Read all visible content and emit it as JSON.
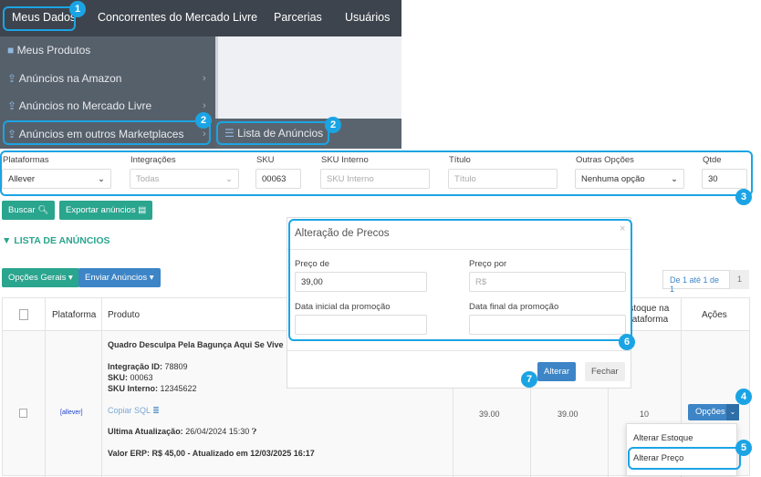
{
  "nav": {
    "tabs": [
      "Meus Dados",
      "Concorrentes do Mercado Livre",
      "Parcerias",
      "Usuários"
    ]
  },
  "submenu": {
    "items": [
      "Meus Produtos",
      "Anúncios na Amazon",
      "Anúncios no Mercado Livre",
      "Anúncios em outros Marketplaces"
    ],
    "flyout": "Lista de Anúncios"
  },
  "filters": {
    "plataformas": {
      "label": "Plataformas",
      "value": "Allever"
    },
    "integracoes": {
      "label": "Integrações",
      "value": "Todas"
    },
    "sku": {
      "label": "SKU",
      "value": "00063"
    },
    "sku_interno": {
      "label": "SKU Interno",
      "placeholder": "SKU Interno"
    },
    "titulo": {
      "label": "Título",
      "placeholder": "Título"
    },
    "outras": {
      "label": "Outras Opções",
      "value": "Nenhuma opção"
    },
    "qtde": {
      "label": "Qtde",
      "value": "30"
    }
  },
  "buttons": {
    "buscar": "Buscar",
    "exportar": "Exportar anúncios",
    "opcoes_gerais": "Opções Gerais",
    "enviar": "Enviar Anúncios"
  },
  "list_title": "LISTA DE ANÚNCIOS",
  "pagination": {
    "info": "De 1 até 1 de 1",
    "page": "1"
  },
  "table": {
    "headers": {
      "plataforma": "Plataforma",
      "produto": "Produto",
      "estoque": "Estoque na Plataforma",
      "acoes": "Ações"
    },
    "row": {
      "plataforma": "[allever]",
      "title": "Quadro Desculpa Pela Bagunça Aqui Se Vive",
      "integ_label": "Integração ID:",
      "integ": "78809",
      "sku_label": "SKU:",
      "sku": "00063",
      "skui_label": "SKU Interno:",
      "skui": "12345622",
      "copiar": "Copiar SQL",
      "upd_label": "Ultima Atualização:",
      "upd": "26/04/2024 15:30",
      "erp": "Valor ERP: R$ 45,00 - Atualizado em 12/03/2025 16:17",
      "preco_de": "39.00",
      "preco_por": "39.00",
      "estoque": "10",
      "opcoes": "Opções"
    }
  },
  "dropdown": [
    "Alterar Estoque",
    "Alterar Preço"
  ],
  "modal": {
    "title": "Alteração de Precos",
    "preco_de_label": "Preço de",
    "preco_de": "39,00",
    "preco_por_label": "Preço por",
    "preco_por_ph": "R$",
    "data_ini_label": "Data inicial da promoção",
    "data_fim_label": "Data final da promoção",
    "alterar": "Alterar",
    "fechar": "Fechar"
  },
  "badges": [
    "1",
    "2",
    "2",
    "3",
    "4",
    "5",
    "6",
    "7"
  ]
}
